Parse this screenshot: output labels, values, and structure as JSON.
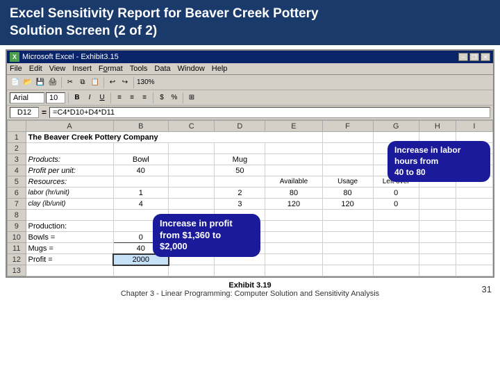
{
  "header": {
    "title_line1": "Excel Sensitivity Report for Beaver Creek Pottery",
    "title_line2": "Solution Screen (2 of 2)"
  },
  "titlebar": {
    "app": "Microsoft Excel - Exhibit3.15",
    "min": "–",
    "restore": "❐",
    "close": "✕"
  },
  "menubar": {
    "items": [
      "File",
      "Edit",
      "View",
      "Insert",
      "Format",
      "Tools",
      "Data",
      "Window",
      "Help"
    ]
  },
  "formulabar": {
    "cellref": "D12",
    "formula": "=C4*D10+D4*D11"
  },
  "spreadsheet": {
    "company": "The Beaver Creek Pottery Company",
    "columns": [
      "",
      "A",
      "B",
      "C",
      "D",
      "E",
      "F",
      "G"
    ],
    "rows": [
      {
        "num": "1",
        "cells": {
          "a": "The Beaver Creek Pottery Company",
          "b": "",
          "c": "",
          "d": "",
          "e": "",
          "f": "",
          "g": ""
        }
      },
      {
        "num": "2",
        "cells": {}
      },
      {
        "num": "3",
        "cells": {
          "a": "Products:",
          "b": "Bowl",
          "c": "",
          "d": "Mug",
          "e": "",
          "f": "",
          "g": ""
        }
      },
      {
        "num": "4",
        "cells": {
          "a": "Profit per unit:",
          "b": "40",
          "c": "",
          "d": "50",
          "e": "",
          "f": "",
          "g": ""
        }
      },
      {
        "num": "5",
        "cells": {
          "a": "Resources:",
          "b": "",
          "c": "",
          "d": "",
          "e": "Available",
          "f": "Usage",
          "g": "Left over"
        }
      },
      {
        "num": "6",
        "cells": {
          "a": "labor (hr/unit)",
          "b": "1",
          "c": "",
          "d": "2",
          "e": "80",
          "f": "80",
          "g": "0"
        }
      },
      {
        "num": "7",
        "cells": {
          "a": "clay (lb/unit)",
          "b": "4",
          "c": "",
          "d": "3",
          "e": "120",
          "f": "120",
          "g": "0"
        }
      },
      {
        "num": "8",
        "cells": {}
      },
      {
        "num": "9",
        "cells": {
          "a": "Production:"
        }
      },
      {
        "num": "10",
        "cells": {
          "a": "Bowls =",
          "b": "0"
        }
      },
      {
        "num": "11",
        "cells": {
          "a": "Mugs =",
          "b": "40"
        }
      },
      {
        "num": "12",
        "cells": {
          "a": "Profit =",
          "b": "2000",
          "selected": true
        }
      },
      {
        "num": "13",
        "cells": {}
      }
    ]
  },
  "callouts": {
    "labor": {
      "line1": "Increase in labor",
      "line2": "hours from",
      "line3": "40 to 80"
    },
    "profit": {
      "line1": "Increase in profit",
      "line2": "from $1,360 to",
      "line3": "$2,000"
    }
  },
  "footer": {
    "exhibit": "Exhibit 3.19",
    "caption": "Chapter 3 - Linear Programming: Computer Solution and Sensitivity Analysis",
    "page": "31"
  }
}
